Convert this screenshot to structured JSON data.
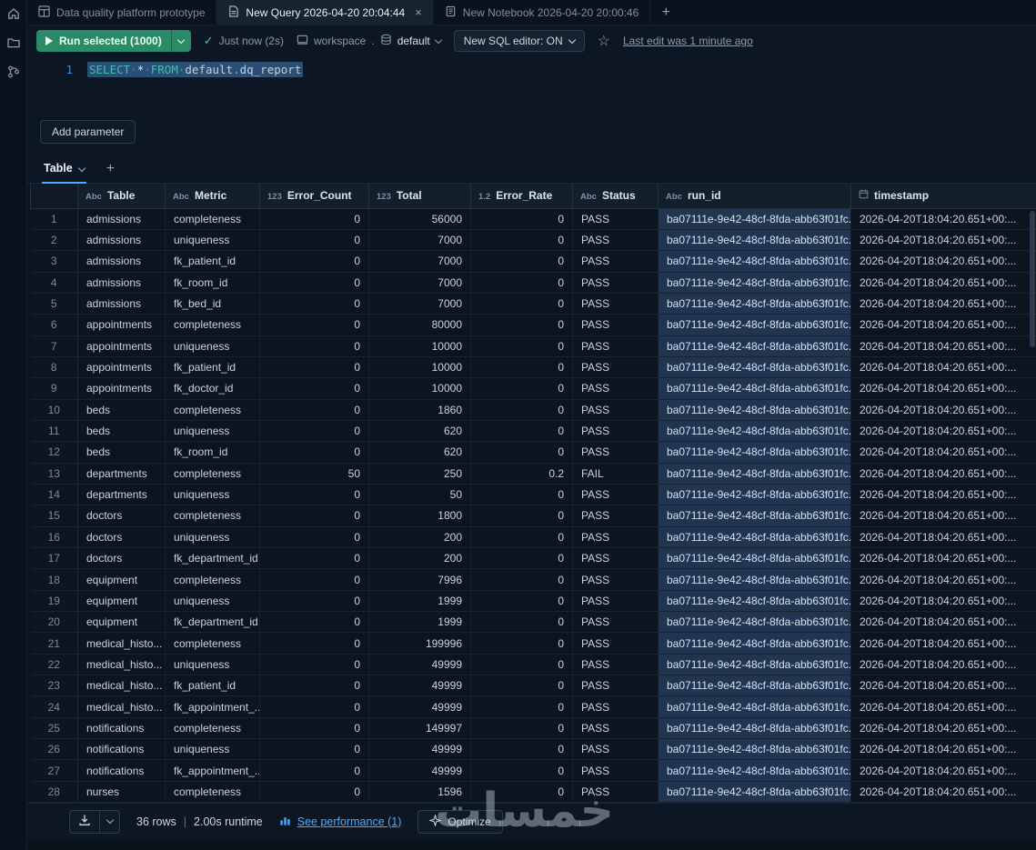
{
  "colors": {
    "accent": "#4fa8ff",
    "run_green": "#2a8c66",
    "selection": "#2b4f74"
  },
  "tabbar": {
    "tabs": [
      {
        "label": "Data quality platform prototype",
        "active": false
      },
      {
        "label": "New Query 2026-04-20 20:04:44",
        "active": true,
        "close": "×"
      },
      {
        "label": "New Notebook 2026-04-20 20:00:46",
        "active": false
      }
    ],
    "new_tab_label": "+"
  },
  "toolbar": {
    "run_label": "Run selected  (1000)",
    "run_status": "Just now (2s)",
    "workspace_label": "workspace",
    "path_separator": ".",
    "catalog_label": "default",
    "sql_editor_toggle": "New SQL editor: ON",
    "last_edit": "Last edit was 1 minute ago"
  },
  "editor": {
    "line_number": "1",
    "tokens": [
      {
        "text": "SELECT",
        "type": "kw"
      },
      {
        "text": "·",
        "type": "ws"
      },
      {
        "text": "*",
        "type": "op"
      },
      {
        "text": "·",
        "type": "ws"
      },
      {
        "text": "FROM",
        "type": "kw"
      },
      {
        "text": "·",
        "type": "ws"
      },
      {
        "text": "default",
        "type": "id"
      },
      {
        "text": ".",
        "type": "dot"
      },
      {
        "text": "dq_report",
        "type": "id"
      }
    ]
  },
  "params": {
    "add_button_label": "Add parameter"
  },
  "results": {
    "active_tab_label": "Table",
    "add_tab_label": "+",
    "columns": [
      {
        "label": "Table",
        "icon": "abc-icon",
        "align": "left"
      },
      {
        "label": "Metric",
        "icon": "abc-icon",
        "align": "left"
      },
      {
        "label": "Error_Count",
        "icon": "int-icon",
        "align": "right"
      },
      {
        "label": "Total",
        "icon": "int-icon",
        "align": "right"
      },
      {
        "label": "Error_Rate",
        "icon": "decimal-icon",
        "align": "right"
      },
      {
        "label": "Status",
        "icon": "abc-icon",
        "align": "left"
      },
      {
        "label": "run_id",
        "icon": "abc-icon",
        "align": "left"
      },
      {
        "label": "timestamp",
        "icon": "calendar-icon",
        "align": "left"
      }
    ],
    "rows": [
      [
        "admissions",
        "completeness",
        0,
        56000,
        0,
        "PASS",
        "ba07111e-9e42-48cf-8fda-abb63f01fc...",
        "2026-04-20T18:04:20.651+00:..."
      ],
      [
        "admissions",
        "uniqueness",
        0,
        7000,
        0,
        "PASS",
        "ba07111e-9e42-48cf-8fda-abb63f01fc...",
        "2026-04-20T18:04:20.651+00:..."
      ],
      [
        "admissions",
        "fk_patient_id",
        0,
        7000,
        0,
        "PASS",
        "ba07111e-9e42-48cf-8fda-abb63f01fc...",
        "2026-04-20T18:04:20.651+00:..."
      ],
      [
        "admissions",
        "fk_room_id",
        0,
        7000,
        0,
        "PASS",
        "ba07111e-9e42-48cf-8fda-abb63f01fc...",
        "2026-04-20T18:04:20.651+00:..."
      ],
      [
        "admissions",
        "fk_bed_id",
        0,
        7000,
        0,
        "PASS",
        "ba07111e-9e42-48cf-8fda-abb63f01fc...",
        "2026-04-20T18:04:20.651+00:..."
      ],
      [
        "appointments",
        "completeness",
        0,
        80000,
        0,
        "PASS",
        "ba07111e-9e42-48cf-8fda-abb63f01fc...",
        "2026-04-20T18:04:20.651+00:..."
      ],
      [
        "appointments",
        "uniqueness",
        0,
        10000,
        0,
        "PASS",
        "ba07111e-9e42-48cf-8fda-abb63f01fc...",
        "2026-04-20T18:04:20.651+00:..."
      ],
      [
        "appointments",
        "fk_patient_id",
        0,
        10000,
        0,
        "PASS",
        "ba07111e-9e42-48cf-8fda-abb63f01fc...",
        "2026-04-20T18:04:20.651+00:..."
      ],
      [
        "appointments",
        "fk_doctor_id",
        0,
        10000,
        0,
        "PASS",
        "ba07111e-9e42-48cf-8fda-abb63f01fc...",
        "2026-04-20T18:04:20.651+00:..."
      ],
      [
        "beds",
        "completeness",
        0,
        1860,
        0,
        "PASS",
        "ba07111e-9e42-48cf-8fda-abb63f01fc...",
        "2026-04-20T18:04:20.651+00:..."
      ],
      [
        "beds",
        "uniqueness",
        0,
        620,
        0,
        "PASS",
        "ba07111e-9e42-48cf-8fda-abb63f01fc...",
        "2026-04-20T18:04:20.651+00:..."
      ],
      [
        "beds",
        "fk_room_id",
        0,
        620,
        0,
        "PASS",
        "ba07111e-9e42-48cf-8fda-abb63f01fc...",
        "2026-04-20T18:04:20.651+00:..."
      ],
      [
        "departments",
        "completeness",
        50,
        250,
        0.2,
        "FAIL",
        "ba07111e-9e42-48cf-8fda-abb63f01fc...",
        "2026-04-20T18:04:20.651+00:..."
      ],
      [
        "departments",
        "uniqueness",
        0,
        50,
        0,
        "PASS",
        "ba07111e-9e42-48cf-8fda-abb63f01fc...",
        "2026-04-20T18:04:20.651+00:..."
      ],
      [
        "doctors",
        "completeness",
        0,
        1800,
        0,
        "PASS",
        "ba07111e-9e42-48cf-8fda-abb63f01fc...",
        "2026-04-20T18:04:20.651+00:..."
      ],
      [
        "doctors",
        "uniqueness",
        0,
        200,
        0,
        "PASS",
        "ba07111e-9e42-48cf-8fda-abb63f01fc...",
        "2026-04-20T18:04:20.651+00:..."
      ],
      [
        "doctors",
        "fk_department_id",
        0,
        200,
        0,
        "PASS",
        "ba07111e-9e42-48cf-8fda-abb63f01fc...",
        "2026-04-20T18:04:20.651+00:..."
      ],
      [
        "equipment",
        "completeness",
        0,
        7996,
        0,
        "PASS",
        "ba07111e-9e42-48cf-8fda-abb63f01fc...",
        "2026-04-20T18:04:20.651+00:..."
      ],
      [
        "equipment",
        "uniqueness",
        0,
        1999,
        0,
        "PASS",
        "ba07111e-9e42-48cf-8fda-abb63f01fc...",
        "2026-04-20T18:04:20.651+00:..."
      ],
      [
        "equipment",
        "fk_department_id",
        0,
        1999,
        0,
        "PASS",
        "ba07111e-9e42-48cf-8fda-abb63f01fc...",
        "2026-04-20T18:04:20.651+00:..."
      ],
      [
        "medical_histo...",
        "completeness",
        0,
        199996,
        0,
        "PASS",
        "ba07111e-9e42-48cf-8fda-abb63f01fc...",
        "2026-04-20T18:04:20.651+00:..."
      ],
      [
        "medical_histo...",
        "uniqueness",
        0,
        49999,
        0,
        "PASS",
        "ba07111e-9e42-48cf-8fda-abb63f01fc...",
        "2026-04-20T18:04:20.651+00:..."
      ],
      [
        "medical_histo...",
        "fk_patient_id",
        0,
        49999,
        0,
        "PASS",
        "ba07111e-9e42-48cf-8fda-abb63f01fc...",
        "2026-04-20T18:04:20.651+00:..."
      ],
      [
        "medical_histo...",
        "fk_appointment_...",
        0,
        49999,
        0,
        "PASS",
        "ba07111e-9e42-48cf-8fda-abb63f01fc...",
        "2026-04-20T18:04:20.651+00:..."
      ],
      [
        "notifications",
        "completeness",
        0,
        149997,
        0,
        "PASS",
        "ba07111e-9e42-48cf-8fda-abb63f01fc...",
        "2026-04-20T18:04:20.651+00:..."
      ],
      [
        "notifications",
        "uniqueness",
        0,
        49999,
        0,
        "PASS",
        "ba07111e-9e42-48cf-8fda-abb63f01fc...",
        "2026-04-20T18:04:20.651+00:..."
      ],
      [
        "notifications",
        "fk_appointment_...",
        0,
        49999,
        0,
        "PASS",
        "ba07111e-9e42-48cf-8fda-abb63f01fc...",
        "2026-04-20T18:04:20.651+00:..."
      ],
      [
        "nurses",
        "completeness",
        0,
        1596,
        0,
        "PASS",
        "ba07111e-9e42-48cf-8fda-abb63f01fc...",
        "2026-04-20T18:04:20.651+00:..."
      ]
    ]
  },
  "footer": {
    "rows_count": "36 rows",
    "separator": "|",
    "runtime": "2.00s runtime",
    "see_performance": "See performance (1)",
    "optimize_label": "Optimize"
  },
  "watermark": {
    "text": "خمسات"
  }
}
